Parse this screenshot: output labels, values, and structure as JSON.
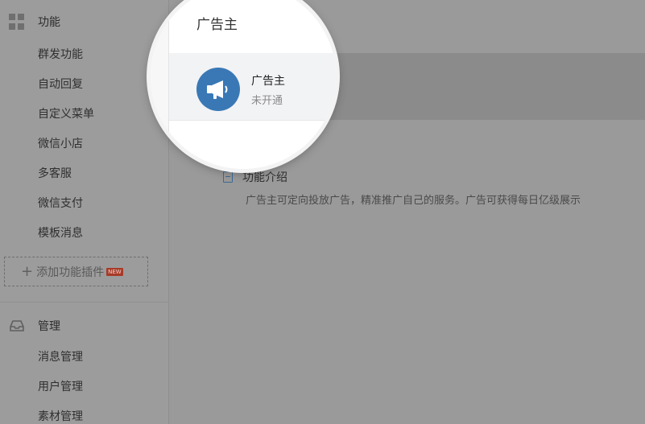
{
  "sidebar": {
    "sections": [
      {
        "icon": "grid-icon",
        "label": "功能",
        "items": [
          "群发功能",
          "自动回复",
          "自定义菜单",
          "微信小店",
          "多客服",
          "微信支付",
          "模板消息"
        ]
      },
      {
        "icon": "inbox-icon",
        "label": "管理",
        "items": [
          "消息管理",
          "用户管理",
          "素材管理"
        ]
      }
    ],
    "add_plugin": {
      "label": "添加功能插件",
      "badge": "NEW"
    }
  },
  "main": {
    "title": "广告主",
    "plugin": {
      "icon": "megaphone-icon",
      "name": "广告主",
      "status": "未开通"
    },
    "intro": {
      "title": "功能介绍",
      "description": "广告主可定向投放广告，精准推广自己的服务。广告可获得每日亿级展示"
    }
  },
  "colors": {
    "accent": "#3a78b5",
    "badge": "#a73a28"
  }
}
